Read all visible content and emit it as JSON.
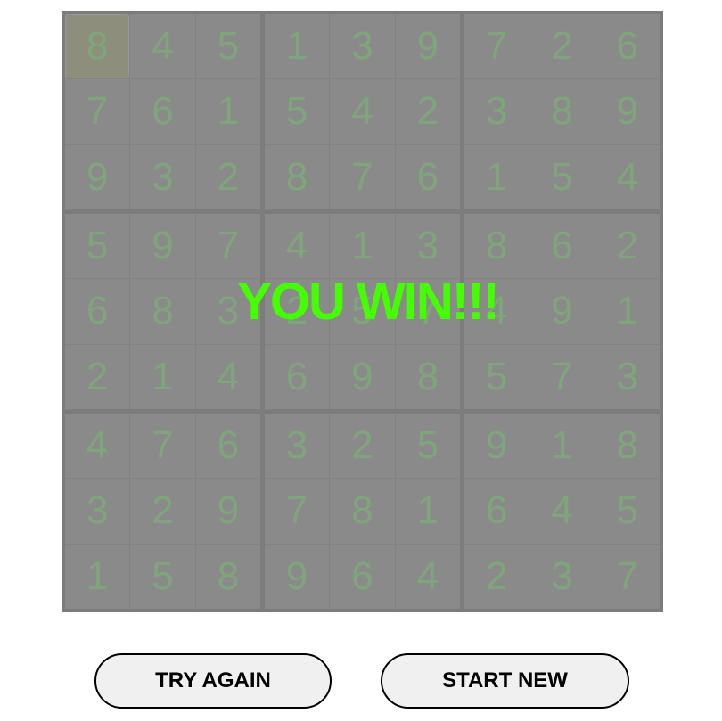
{
  "game": {
    "grid": [
      [
        8,
        4,
        5,
        1,
        3,
        9,
        7,
        2,
        6
      ],
      [
        7,
        6,
        1,
        5,
        4,
        2,
        3,
        8,
        9
      ],
      [
        9,
        3,
        2,
        8,
        7,
        6,
        1,
        5,
        4
      ],
      [
        5,
        9,
        7,
        4,
        1,
        3,
        8,
        6,
        2
      ],
      [
        6,
        8,
        3,
        2,
        5,
        7,
        4,
        9,
        1
      ],
      [
        2,
        1,
        4,
        6,
        9,
        8,
        5,
        7,
        3
      ],
      [
        4,
        7,
        6,
        3,
        2,
        5,
        9,
        1,
        8
      ],
      [
        3,
        2,
        9,
        7,
        8,
        1,
        6,
        4,
        5
      ],
      [
        1,
        5,
        8,
        9,
        6,
        4,
        2,
        3,
        7
      ]
    ],
    "selected_cell": [
      0,
      0
    ],
    "win_message": "YOU WIN!!!"
  },
  "buttons": {
    "try_again": "TRY AGAIN",
    "start_new": "START NEW"
  },
  "colors": {
    "board_bg": "#7c7c7c",
    "cell_bg": "#8a8a8a",
    "digit": "#7fa67a",
    "win_text": "#44ff00",
    "button_bg": "#f0f0f0"
  }
}
